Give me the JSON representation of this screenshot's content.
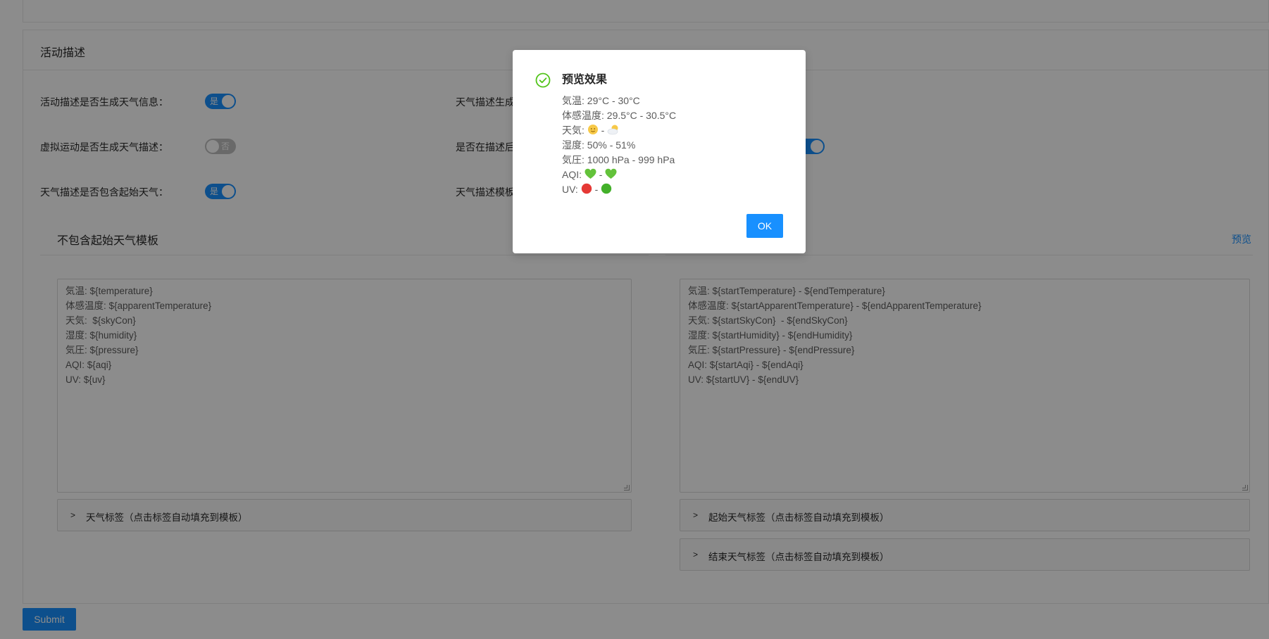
{
  "section": {
    "title": "活动描述"
  },
  "form": {
    "left": [
      {
        "label": "活动描述是否生成天气信息：",
        "switch_text": "是",
        "on": true
      },
      {
        "label": "虚拟运动是否生成天气描述：",
        "switch_text": "否",
        "on": false
      },
      {
        "label": "天气描述是否包含起始天气：",
        "switch_text": "是",
        "on": true
      }
    ],
    "right_partial": [
      "天气描述生成",
      "是否在描述后",
      "天气描述模板"
    ]
  },
  "template_left": {
    "title": "不包含起始天气模板",
    "lines": [
      "気温: ${temperature}",
      "体感温度: ${apparentTemperature}",
      "天気:  ${skyCon}",
      "湿度: ${humidity}",
      "気圧: ${pressure}",
      "AQI: ${aqi}",
      "UV: ${uv}"
    ],
    "tags_label": "天气标签（点击标签自动填充到模板）"
  },
  "template_right": {
    "preview_label": "预览",
    "lines": [
      "気温: ${startTemperature} - ${endTemperature}",
      "体感温度: ${startApparentTemperature} - ${endApparentTemperature}",
      "天気: ${startSkyCon}  - ${endSkyCon}",
      "湿度: ${startHumidity} - ${endHumidity}",
      "気圧: ${startPressure} - ${endPressure}",
      "AQI: ${startAqi} - ${endAqi}",
      "UV: ${startUV} - ${endUV}"
    ],
    "start_tags_label": "起始天气标签（点击标签自动填充到模板）",
    "end_tags_label": "结束天气标签（点击标签自动填充到模板）"
  },
  "submit_label": "Submit",
  "modal": {
    "title": "预览效果",
    "lines": [
      "気温: 29°C - 30°C",
      "体感温度: 29.5°C - 30.5°C",
      "天気:",
      "湿度: 50% - 51%",
      "気圧: 1000 hPa - 999 hPa",
      "AQI:",
      "UV:"
    ],
    "separator": "-",
    "ok_label": "OK",
    "emoji": {
      "sky_start": "sun-with-face-icon",
      "sky_end": "sun-behind-cloud-icon",
      "aqi_start": "green-heart-icon",
      "aqi_end": "green-heart-icon",
      "uv_start": "red-circle-icon",
      "uv_end": "green-circle-icon"
    }
  },
  "colors": {
    "primary": "#1890ff",
    "success": "#52c41a",
    "mask": "rgba(0,0,0,0.45)"
  }
}
